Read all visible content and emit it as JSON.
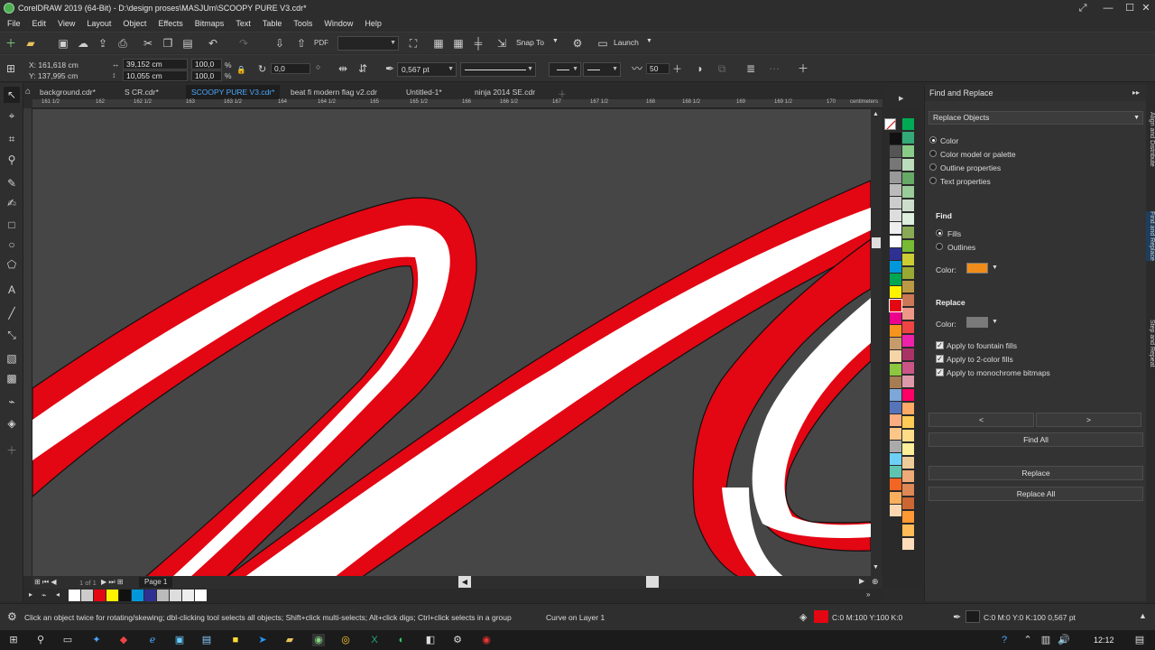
{
  "window": {
    "title": "CorelDRAW 2019 (64-Bit) - D:\\design proses\\MASJUm\\SCOOPY PURE V3.cdr*",
    "minimize": "—",
    "maximize": "☐",
    "close": "✕"
  },
  "menu": [
    "File",
    "Edit",
    "View",
    "Layout",
    "Object",
    "Effects",
    "Bitmaps",
    "Text",
    "Table",
    "Tools",
    "Window",
    "Help"
  ],
  "std_toolbar": {
    "snap_to": "Snap To",
    "launch": "Launch"
  },
  "property_bar": {
    "x": "X: 161,618 cm",
    "y": "Y: 137,995 cm",
    "width": "39,152 cm",
    "height": "10,055 cm",
    "scale_x": "100,0",
    "scale_y": "100,0",
    "pct": "%",
    "rotation": "0,0",
    "outline_width": "0,567 pt",
    "smoothing": "50"
  },
  "doc_tabs": [
    {
      "label": "background.cdr*",
      "active": false
    },
    {
      "label": "S CR.cdr*",
      "active": false
    },
    {
      "label": "SCOOPY PURE V3.cdr*",
      "active": true
    },
    {
      "label": "beat fi modern flag v2.cdr",
      "active": false
    },
    {
      "label": "Untitled-1*",
      "active": false
    },
    {
      "label": "ninja 2014 SE.cdr",
      "active": false
    }
  ],
  "ruler_labels": [
    "161 1/2",
    "162",
    "162 1/2",
    "163",
    "163 1/2",
    "164",
    "164 1/2",
    "165",
    "165 1/2",
    "166",
    "166 1/2",
    "167",
    "167 1/2",
    "168",
    "168 1/2",
    "169",
    "169 1/2",
    "170",
    "centimeters"
  ],
  "page_nav": {
    "of_label": "1 of 1",
    "page_tab": "Page 1"
  },
  "docker": {
    "title": "Find and Replace",
    "mode": "Replace Objects",
    "types": [
      "Color",
      "Color model or palette",
      "Outline properties",
      "Text properties"
    ],
    "find_heading": "Find",
    "find_options": [
      "Fills",
      "Outlines"
    ],
    "color_label": "Color:",
    "find_color": "#f08c1a",
    "replace_heading": "Replace",
    "replace_color_label": "Color:",
    "replace_color": "#7a7a7a",
    "checks": [
      "Apply to fountain fills",
      "Apply to 2-color fills",
      "Apply to monochrome bitmaps"
    ],
    "prev": "<",
    "next": ">",
    "find_all": "Find All",
    "replace": "Replace",
    "replace_all": "Replace All",
    "side_tabs": [
      "Align and Distribute",
      "Find and Replace",
      "Step and Repeat"
    ]
  },
  "status": {
    "hint": "Click an object twice for rotating/skewing; dbl-clicking tool selects all objects; Shift+click multi-selects; Alt+click digs; Ctrl+click selects in a group",
    "selection": "Curve on Layer 1",
    "fill_info": "C:0 M:100 Y:100 K:0",
    "outline_info": "C:0 M:0 Y:0 K:100  0,567 pt",
    "fill_color": "#e30613"
  },
  "taskbar": {
    "time": "12:12"
  },
  "colors": {
    "red": "#e30613",
    "white": "#ffffff",
    "canvas": "#464646"
  }
}
